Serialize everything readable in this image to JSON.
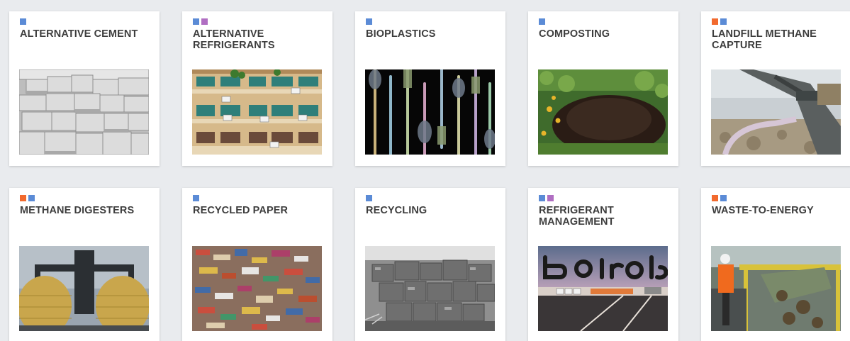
{
  "colors": {
    "blue": "#5b8bd6",
    "purple": "#b06ec2",
    "orange": "#f26a2e"
  },
  "cards": [
    {
      "title": "ALTERNATIVE CEMENT",
      "tags": [
        "blue"
      ],
      "image": "cement-blocks-image"
    },
    {
      "title": "ALTERNATIVE REFRIGERANTS",
      "tags": [
        "blue",
        "purple"
      ],
      "image": "apartment-air-conditioners-image"
    },
    {
      "title": "BIOPLASTICS",
      "tags": [
        "blue"
      ],
      "image": "plastic-cutlery-image"
    },
    {
      "title": "COMPOSTING",
      "tags": [
        "blue"
      ],
      "image": "compost-pile-image"
    },
    {
      "title": "LANDFILL METHANE CAPTURE",
      "tags": [
        "orange",
        "blue"
      ],
      "image": "landfill-pipe-image"
    },
    {
      "title": "METHANE DIGESTERS",
      "tags": [
        "orange",
        "blue"
      ],
      "image": "digester-eggs-image"
    },
    {
      "title": "RECYCLED PAPER",
      "tags": [
        "blue"
      ],
      "image": "shredded-paper-image"
    },
    {
      "title": "RECYCLING",
      "tags": [
        "blue"
      ],
      "image": "crushed-metal-bales-image"
    },
    {
      "title": "REFRIGERANT MANAGEMENT",
      "tags": [
        "blue",
        "purple"
      ],
      "image": "rooftop-sign-image"
    },
    {
      "title": "WASTE-TO-ENERGY",
      "tags": [
        "orange",
        "blue"
      ],
      "image": "waste-facility-image"
    }
  ]
}
